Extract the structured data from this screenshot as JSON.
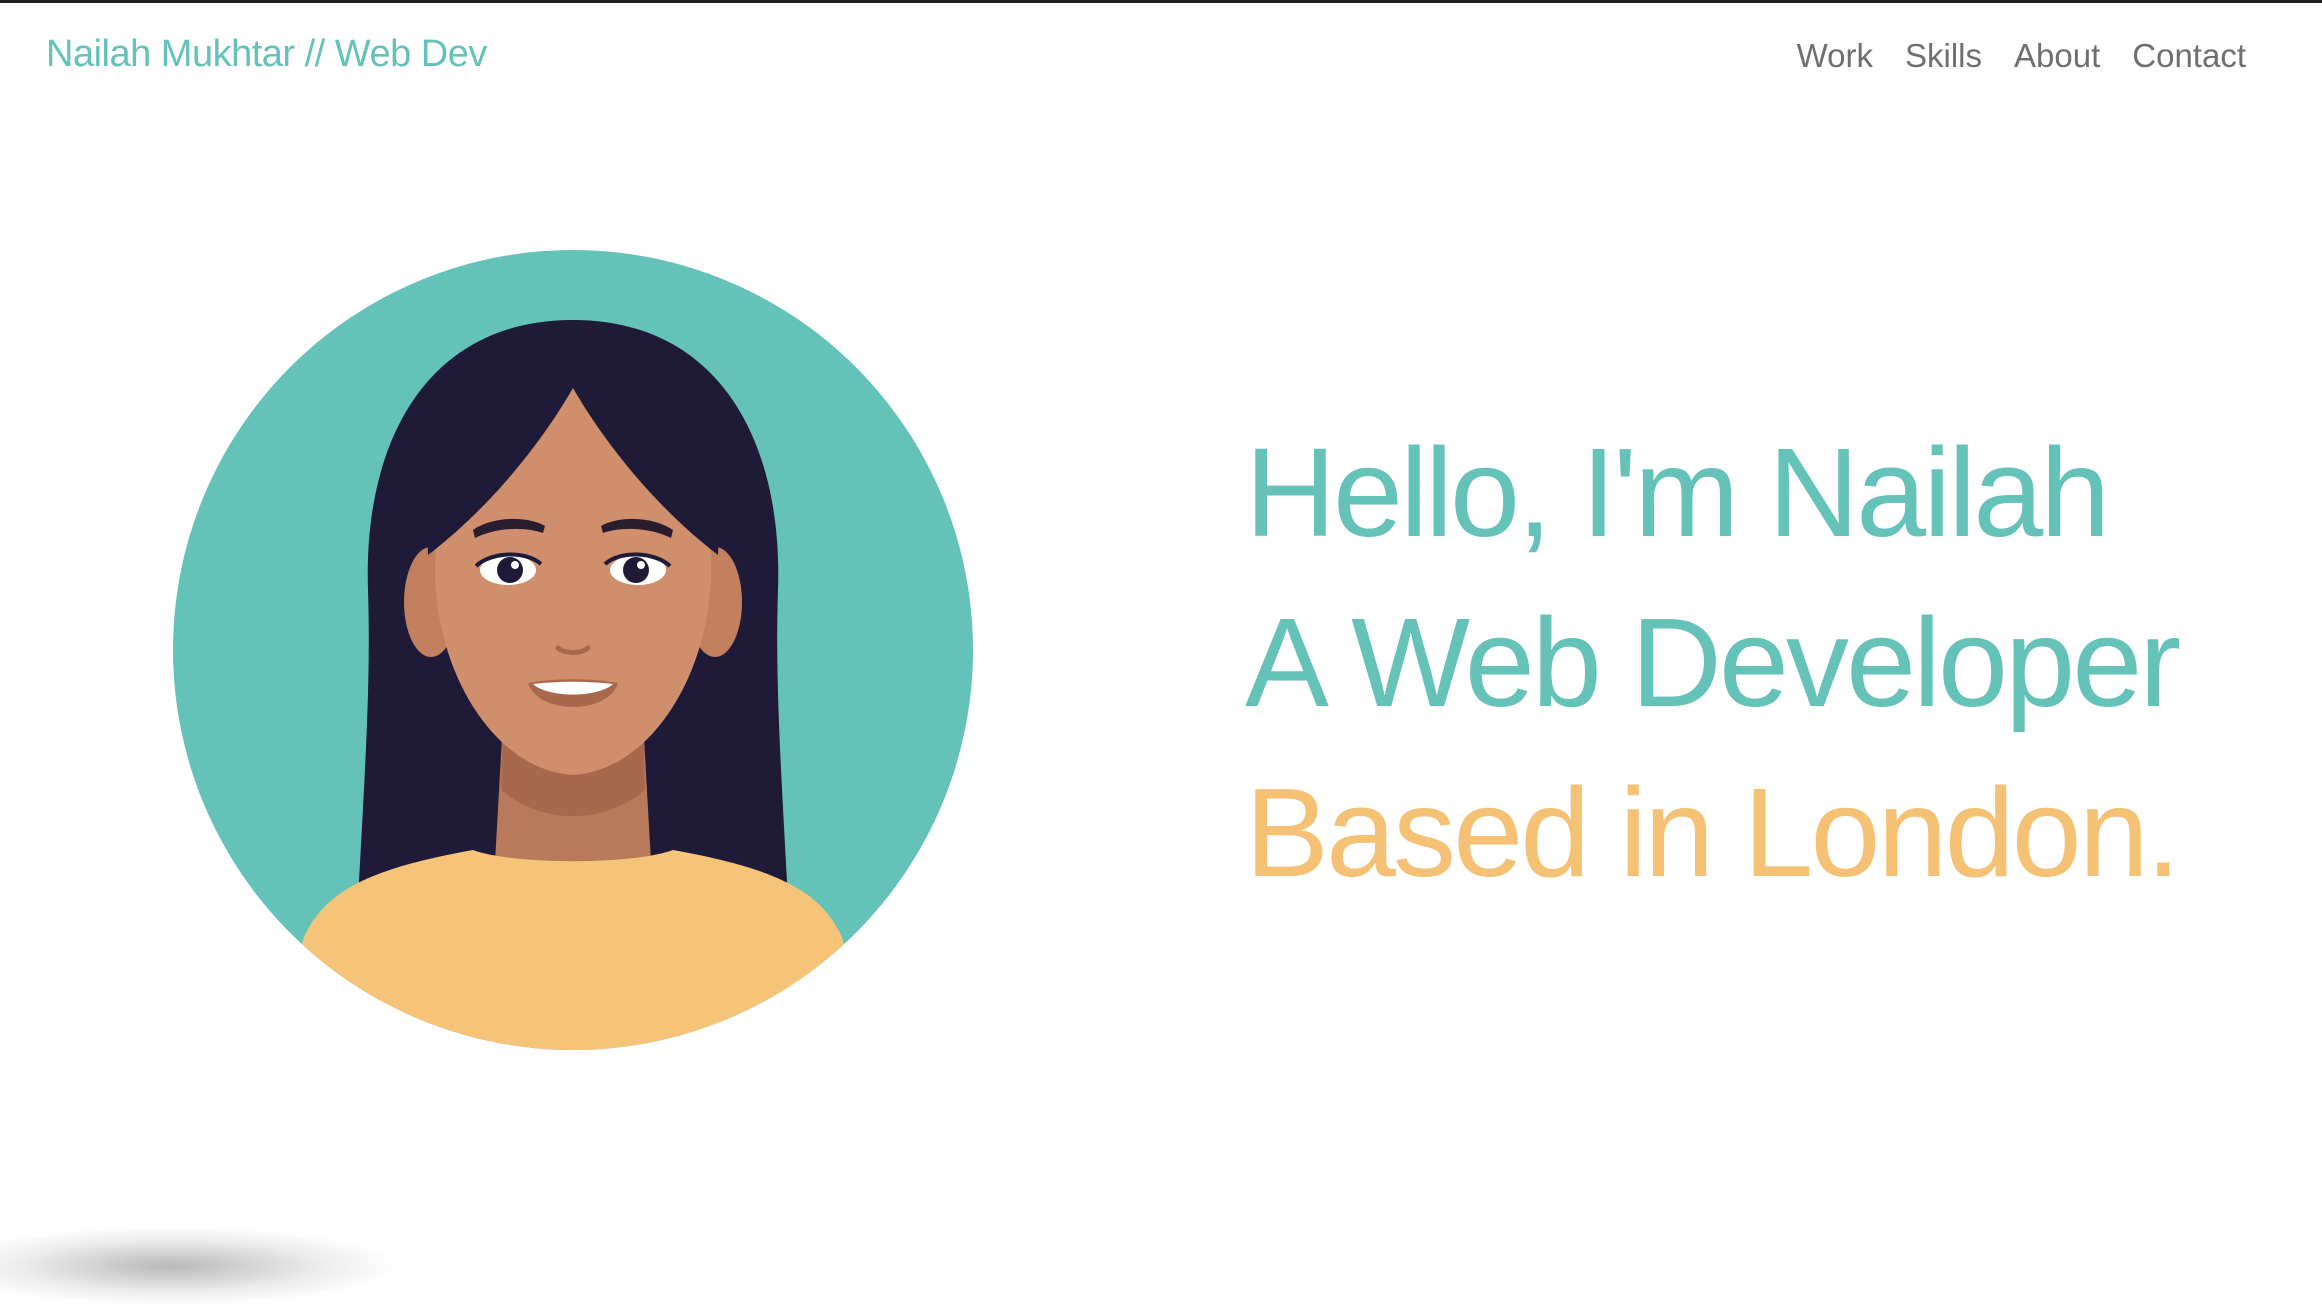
{
  "header": {
    "brand": "Nailah Mukhtar // Web Dev",
    "nav": [
      {
        "label": "Work"
      },
      {
        "label": "Skills"
      },
      {
        "label": "About"
      },
      {
        "label": "Contact"
      }
    ]
  },
  "hero": {
    "line1": "Hello, I'm Nailah",
    "line2": "A Web Developer",
    "line3": "Based in London."
  },
  "avatar": {
    "icon": "woman-portrait-illustration"
  },
  "colors": {
    "teal": "#64c2b8",
    "amber": "#f4c175",
    "nav_text": "#6f6f6f",
    "hair": "#1f1a38",
    "skin": "#cf8f6d",
    "shirt": "#f6c478"
  }
}
